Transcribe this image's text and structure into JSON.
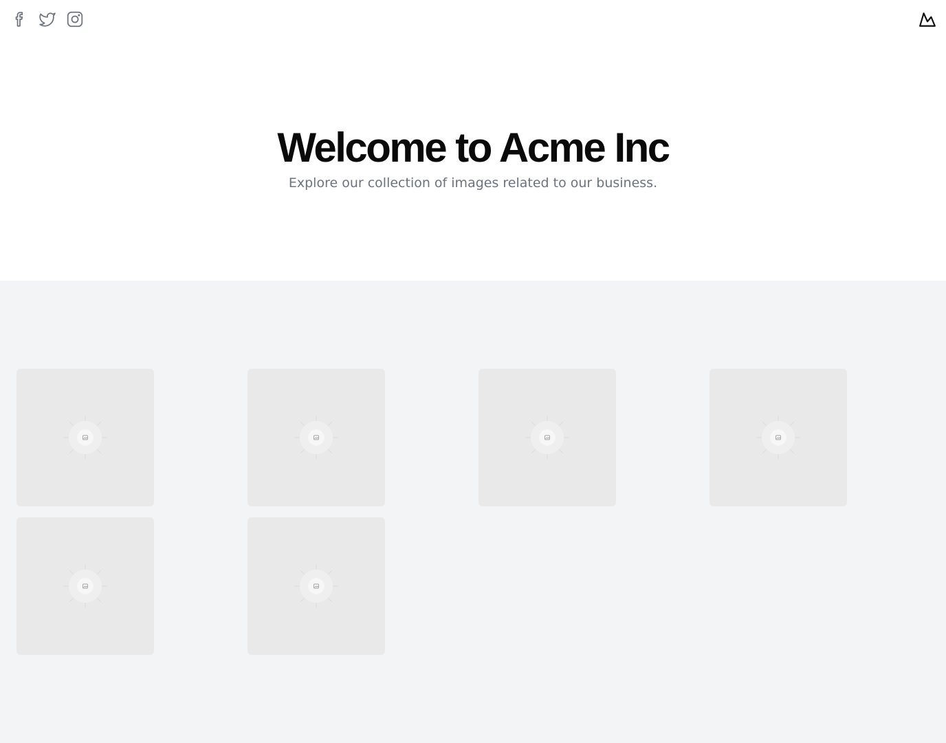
{
  "header": {
    "social": [
      {
        "name": "facebook-icon"
      },
      {
        "name": "twitter-icon"
      },
      {
        "name": "instagram-icon"
      }
    ],
    "logo_icon": "mountain-logo-icon"
  },
  "hero": {
    "title": "Welcome to Acme Inc",
    "subtitle": "Explore our collection of images related to our business."
  },
  "gallery": {
    "images": [
      {
        "icon": "image-placeholder-icon"
      },
      {
        "icon": "image-placeholder-icon"
      },
      {
        "icon": "image-placeholder-icon"
      },
      {
        "icon": "image-placeholder-icon"
      },
      {
        "icon": "image-placeholder-icon"
      },
      {
        "icon": "image-placeholder-icon"
      }
    ]
  },
  "colors": {
    "background": "#ffffff",
    "gallery_background": "#f2f4f6",
    "tile": "#e9e9e9",
    "title": "#0a0a0a",
    "subtitle": "#6b7280",
    "icon": "#6b7280"
  }
}
